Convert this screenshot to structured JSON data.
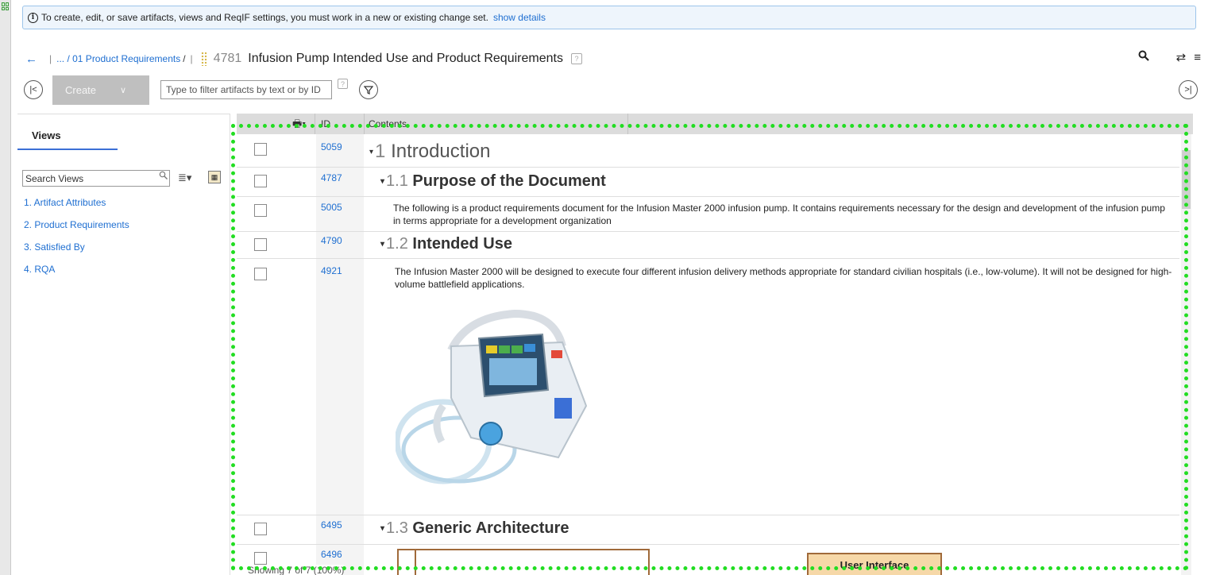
{
  "banner": {
    "message": "To create, edit, or save artifacts, views and ReqIF settings, you must work in a new or existing change set.",
    "link": "show details",
    "icon": "info-icon"
  },
  "breadcrumb": {
    "path": "... / 01 Product Requirements",
    "slash": "/",
    "doc_id": "4781",
    "doc_title": "Infusion Pump Intended Use and Product Requirements",
    "help": "?"
  },
  "toolbar": {
    "create_label": "Create",
    "filter_placeholder": "Type to filter artifacts by text or by ID",
    "filter_help": "?"
  },
  "views": {
    "tab_label": "Views",
    "search_placeholder": "Search Views",
    "items": [
      {
        "label": "1. Artifact Attributes"
      },
      {
        "label": "2. Product Requirements"
      },
      {
        "label": "3. Satisfied By"
      },
      {
        "label": "4. RQA"
      }
    ]
  },
  "grid": {
    "col_id": "ID",
    "col_contents": "Contents",
    "rows": [
      {
        "id": "5059",
        "kind": "heading1",
        "number": "1",
        "title": "Introduction"
      },
      {
        "id": "4787",
        "kind": "heading2",
        "number": "1.1",
        "title": "Purpose of the Document"
      },
      {
        "id": "5005",
        "kind": "text",
        "text": "The following is a product requirements document for the Infusion Master 2000 infusion pump. It contains requirements necessary for the design and development of the infusion pump in terms appropriate for a development organization"
      },
      {
        "id": "4790",
        "kind": "heading2",
        "number": "1.2",
        "title": "Intended Use"
      },
      {
        "id": "4921",
        "kind": "text",
        "text": "The Infusion Master 2000 will be designed to execute four different infusion delivery methods appropriate for standard civilian hospitals (i.e., low-volume). It will not be designed for high-volume battlefield applications."
      },
      {
        "id": "6495",
        "kind": "heading2",
        "number": "1.3",
        "title": "Generic Architecture"
      },
      {
        "id": "6496",
        "kind": "diagram"
      }
    ],
    "diagram_label": "User Interface",
    "showing": "Showing 7 of 7 (100%)"
  },
  "colors": {
    "link": "#1f6fd1",
    "selection": "#22dd22",
    "banner_bg": "#eef5fc"
  }
}
